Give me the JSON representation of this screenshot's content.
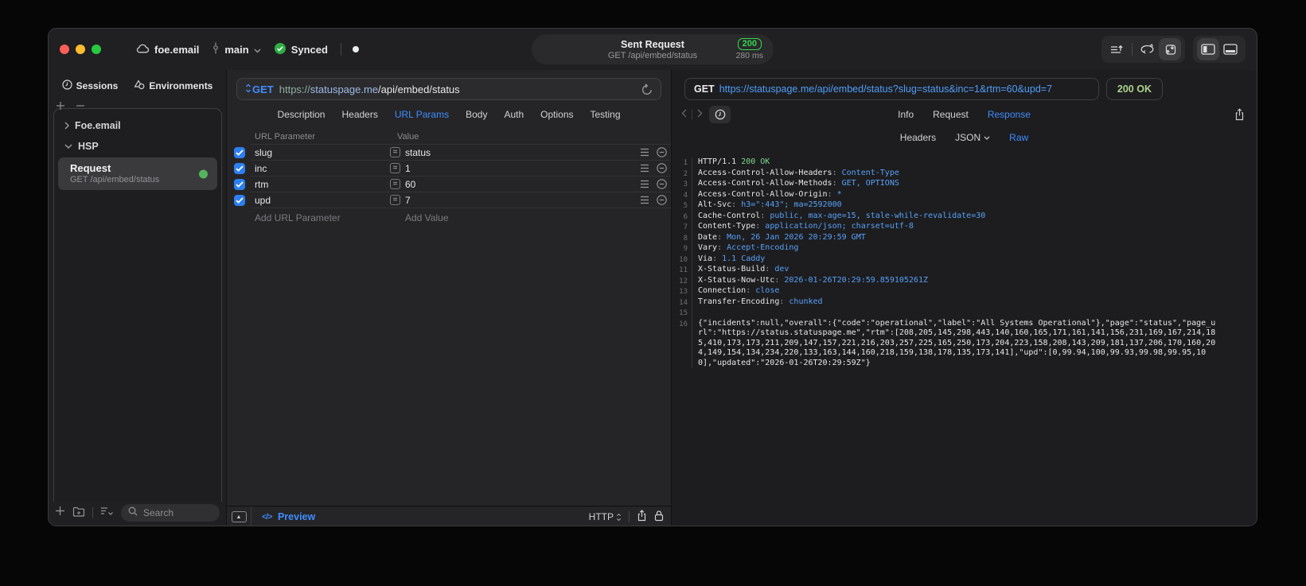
{
  "titlebar": {
    "project": "foe.email",
    "branch": "main",
    "sync_label": "Synced",
    "request_title": "Sent Request",
    "request_subtitle": "GET /api/embed/status",
    "status_code": "200",
    "duration": "280 ms"
  },
  "sidebar": {
    "tab_sessions": "Sessions",
    "tab_environments": "Environments",
    "group_1": "Foe.email",
    "group_2": "HSP",
    "request_item": {
      "title": "Request",
      "subtitle": "GET /api/embed/status"
    },
    "search_placeholder": "Search"
  },
  "request_panel": {
    "method": "GET",
    "url": {
      "scheme": "https://",
      "host": "statuspage.me",
      "path": "/api/embed/status"
    },
    "tabs": [
      {
        "label": "Description"
      },
      {
        "label": "Headers"
      },
      {
        "label": "URL Params",
        "active": true
      },
      {
        "label": "Body"
      },
      {
        "label": "Auth"
      },
      {
        "label": "Options"
      },
      {
        "label": "Testing"
      }
    ],
    "params": {
      "col_name": "URL Parameter",
      "col_value": "Value",
      "rows": [
        {
          "name": "slug",
          "value": "status",
          "enabled": true
        },
        {
          "name": "inc",
          "value": "1",
          "enabled": true
        },
        {
          "name": "rtm",
          "value": "60",
          "enabled": true
        },
        {
          "name": "upd",
          "value": "7",
          "enabled": true
        }
      ],
      "add_name": "Add URL Parameter",
      "add_value": "Add Value"
    },
    "footer": {
      "code_glyph": "</>",
      "preview": "Preview",
      "protocol": "HTTP"
    }
  },
  "response_panel": {
    "method": "GET",
    "url": "https://statuspage.me/api/embed/status?slug=status&inc=1&rtm=60&upd=7",
    "status": "200 OK",
    "tabs": [
      {
        "label": "Info"
      },
      {
        "label": "Request"
      },
      {
        "label": "Response",
        "active": true
      }
    ],
    "subtabs": [
      {
        "label": "Headers"
      },
      {
        "label": "JSON",
        "dropdown": true
      },
      {
        "label": "Raw",
        "active": true
      }
    ],
    "lines": [
      {
        "n": "1",
        "s": [
          [
            "HTTP/1.1 ",
            "p"
          ],
          [
            "200 OK",
            "g"
          ]
        ]
      },
      {
        "n": "2",
        "s": [
          [
            "Access-Control-Allow-Headers",
            "p"
          ],
          [
            ": ",
            "d"
          ],
          [
            "Content-Type",
            "b"
          ]
        ]
      },
      {
        "n": "3",
        "s": [
          [
            "Access-Control-Allow-Methods",
            "p"
          ],
          [
            ": ",
            "d"
          ],
          [
            "GET, OPTIONS",
            "b"
          ]
        ]
      },
      {
        "n": "4",
        "s": [
          [
            "Access-Control-Allow-Origin",
            "p"
          ],
          [
            ": ",
            "d"
          ],
          [
            "*",
            "b"
          ]
        ]
      },
      {
        "n": "5",
        "s": [
          [
            "Alt-Svc",
            "p"
          ],
          [
            ": ",
            "d"
          ],
          [
            "h3=\":443\"; ma=2592000",
            "b"
          ]
        ]
      },
      {
        "n": "6",
        "s": [
          [
            "Cache-Control",
            "p"
          ],
          [
            ": ",
            "d"
          ],
          [
            "public, max-age=15, stale-while-revalidate=30",
            "b"
          ]
        ]
      },
      {
        "n": "7",
        "s": [
          [
            "Content-Type",
            "p"
          ],
          [
            ": ",
            "d"
          ],
          [
            "application/json; charset=utf-8",
            "b"
          ]
        ]
      },
      {
        "n": "8",
        "s": [
          [
            "Date",
            "p"
          ],
          [
            ": ",
            "d"
          ],
          [
            "Mon, 26 Jan 2026 20:29:59 GMT",
            "b"
          ]
        ]
      },
      {
        "n": "9",
        "s": [
          [
            "Vary",
            "p"
          ],
          [
            ": ",
            "d"
          ],
          [
            "Accept-Encoding",
            "b"
          ]
        ]
      },
      {
        "n": "10",
        "s": [
          [
            "Via",
            "p"
          ],
          [
            ": ",
            "d"
          ],
          [
            "1.1 Caddy",
            "b"
          ]
        ]
      },
      {
        "n": "11",
        "s": [
          [
            "X-Status-Build",
            "p"
          ],
          [
            ": ",
            "d"
          ],
          [
            "dev",
            "b"
          ]
        ]
      },
      {
        "n": "12",
        "s": [
          [
            "X-Status-Now-Utc",
            "p"
          ],
          [
            ": ",
            "d"
          ],
          [
            "2026-01-26T20:29:59.859105261Z",
            "b"
          ]
        ]
      },
      {
        "n": "13",
        "s": [
          [
            "Connection",
            "p"
          ],
          [
            ": ",
            "d"
          ],
          [
            "close",
            "b"
          ]
        ]
      },
      {
        "n": "14",
        "s": [
          [
            "Transfer-Encoding",
            "p"
          ],
          [
            ": ",
            "d"
          ],
          [
            "chunked",
            "b"
          ]
        ]
      },
      {
        "n": "15",
        "s": []
      },
      {
        "n": "16",
        "s": [
          [
            "{\"incidents\":null,\"overall\":{\"code\":\"operational\",\"label\":\"All Systems Operational\"},\"page\":\"status\",\"page_url\":\"https://status.statuspage.me\",\"rtm\":[208,205,145,298,443,140,160,165,171,161,141,156,231,169,167,214,185,410,173,173,211,209,147,157,221,216,203,257,225,165,250,173,204,223,158,208,143,209,181,137,206,170,160,204,149,154,134,234,220,133,163,144,160,218,159,138,178,135,173,141],\"upd\":[0,99.94,100,99.93,99.98,99.95,100],\"updated\":\"2026-01-26T20:29:59Z\"}",
            "p"
          ]
        ]
      }
    ]
  },
  "colors": {
    "accent_blue": "#3f8cff",
    "status_green": "#32d74b",
    "badge_green": "#aed28e",
    "value_blue": "#58a0f8",
    "code_green": "#7cd98c"
  }
}
